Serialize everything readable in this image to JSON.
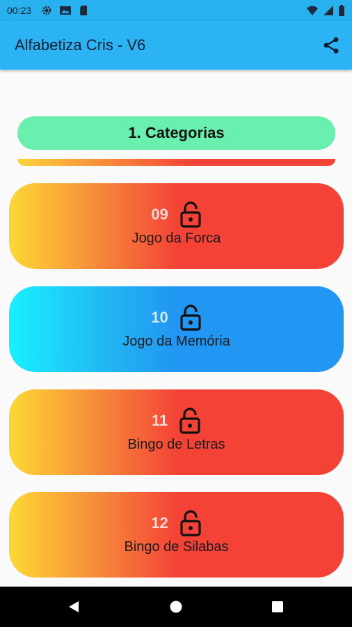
{
  "status_bar": {
    "time": "00:23",
    "icons": [
      "settings-icon",
      "image-icon",
      "sd-card-icon",
      "wifi-icon",
      "signal-icon",
      "battery-icon"
    ]
  },
  "app_bar": {
    "title": "Alfabetiza Cris - V6",
    "share_icon": "share-icon",
    "color": "#2bb3f3"
  },
  "section": {
    "label": "1. Categorias",
    "color": "#69f0ae"
  },
  "cards": [
    {
      "number": "09",
      "label": "Jogo da Forca",
      "theme": "red",
      "icon": "unlock-icon"
    },
    {
      "number": "10",
      "label": "Jogo da Memória",
      "theme": "blue",
      "icon": "unlock-icon"
    },
    {
      "number": "11",
      "label": "Bingo de Letras",
      "theme": "red",
      "icon": "unlock-icon"
    },
    {
      "number": "12",
      "label": "Bingo de Silabas",
      "theme": "red",
      "icon": "unlock-icon"
    }
  ],
  "nav_bar": {
    "buttons": [
      "back-icon",
      "home-icon",
      "recents-icon"
    ]
  },
  "colors": {
    "red_gradient": [
      "#fdd835",
      "#f44336"
    ],
    "blue_gradient": [
      "#18f0fe",
      "#2196f3"
    ]
  }
}
